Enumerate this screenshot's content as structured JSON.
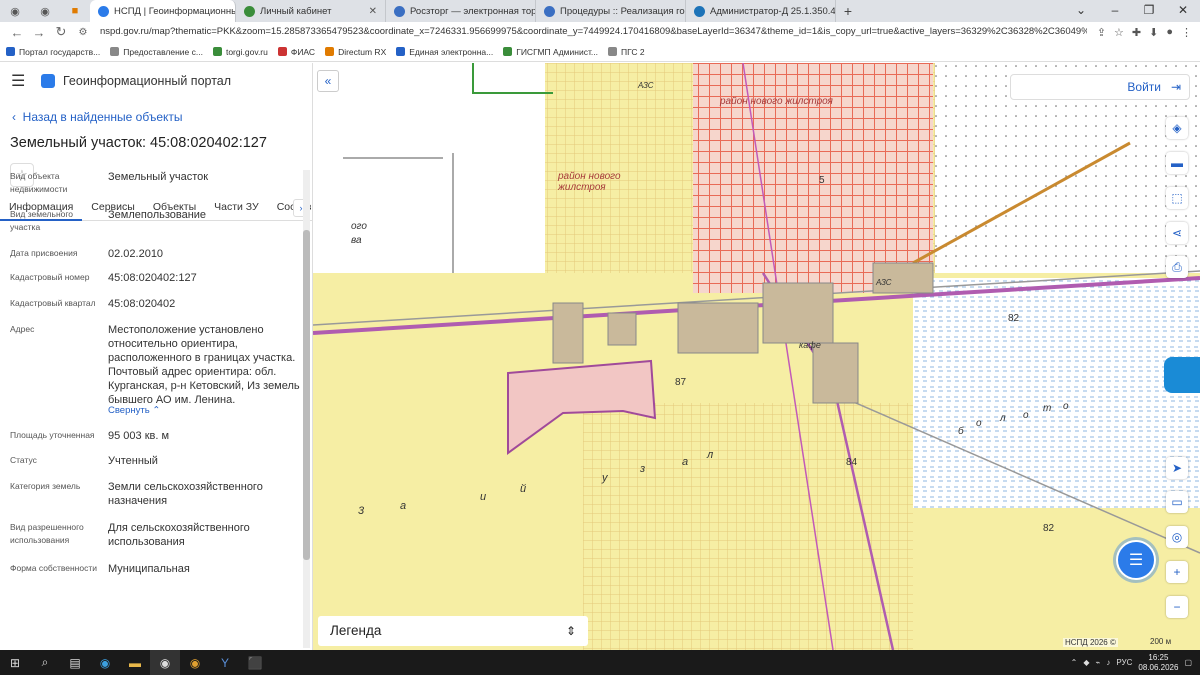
{
  "browser": {
    "tabs": [
      {
        "label": "НСПД | Геоинформационный п",
        "active": true,
        "color": "#2b7be9"
      },
      {
        "label": "Личный кабинет",
        "active": false,
        "color": "#3a8d3a"
      },
      {
        "label": "Росзторг — электронная торг",
        "active": false,
        "color": "#3b6fc2"
      },
      {
        "label": "Процедуры :: Реализация госи",
        "active": false,
        "color": "#3b6fc2"
      },
      {
        "label": "Администратор-Д 25.1.350.417",
        "active": false,
        "color": "#1d73b8"
      }
    ],
    "url": "nspd.gov.ru/map?thematic=PKK&zoom=15.285873365479523&coordinate_x=7246331.956699975&coordinate_y=7449924.170416809&baseLayerId=36347&theme_id=1&is_copy_url=true&active_layers=36329%2C36328%2C36049%2C36473%2C3729...",
    "bookmarks": [
      {
        "label": "Портал государств...",
        "color": "#2461c6"
      },
      {
        "label": "Предоставление с...",
        "color": "#888"
      },
      {
        "label": "torgi.gov.ru",
        "color": "#3a8d3a"
      },
      {
        "label": "ФИАС",
        "color": "#c33"
      },
      {
        "label": "Directum RX",
        "color": "#e07b00"
      },
      {
        "label": "Единая электронна...",
        "color": "#2461c6"
      },
      {
        "label": "ГИСГМП Админист...",
        "color": "#3a8d3a"
      },
      {
        "label": "ПГС 2",
        "color": "#888"
      }
    ]
  },
  "sidebar": {
    "portal_title": "Геоинформационный портал",
    "back_link": "Назад в найденные объекты",
    "object_title": "Земельный участок: 45:08:020402:127",
    "tabs": [
      "Информация",
      "Сервисы",
      "Объекты",
      "Части ЗУ",
      "Состав"
    ],
    "properties": [
      {
        "key": "Вид объекта недвижимости",
        "value": "Земельный участок"
      },
      {
        "key": "Вид земельного участка",
        "value": "Землепользование"
      },
      {
        "key": "Дата присвоения",
        "value": "02.02.2010"
      },
      {
        "key": "Кадастровый номер",
        "value": "45:08:020402:127"
      },
      {
        "key": "Кадастровый квартал",
        "value": "45:08:020402"
      },
      {
        "key": "Адрес",
        "value": "Местоположение установлено относительно ориентира, расположенного в границах участка. Почтовый адрес ориентира: обл. Курганская, р-н Кетовский, Из земель бывшего АО им. Ленина."
      },
      {
        "key": "",
        "value": "Свернуть"
      },
      {
        "key": "Площадь уточненная",
        "value": "95 003 кв. м"
      },
      {
        "key": "Статус",
        "value": "Учтенный"
      },
      {
        "key": "Категория земель",
        "value": "Земли сельскохозяйственного назначения"
      },
      {
        "key": "Вид разрешенного использования",
        "value": "Для сельскохозяйственного использования"
      },
      {
        "key": "Форма собственности",
        "value": "Муниципальная"
      }
    ]
  },
  "map": {
    "login_label": "Войти",
    "legend_label": "Легенда",
    "copyright": "НСПД 2026 ©",
    "scale": "200 м",
    "labels": [
      "район нового жилстроя",
      "район нового жилстроя",
      "кафе",
      "АЗС",
      "82",
      "87",
      "84",
      "82",
      "ого",
      "ва",
      "3",
      "а",
      "и",
      "й",
      "у",
      "з",
      "а",
      "л",
      "б",
      "о",
      "л",
      "о",
      "т",
      "о",
      "5",
      "АЗС"
    ]
  },
  "taskbar": {
    "lang": "РУС",
    "time": "16:25",
    "date": "08.06.2026"
  }
}
